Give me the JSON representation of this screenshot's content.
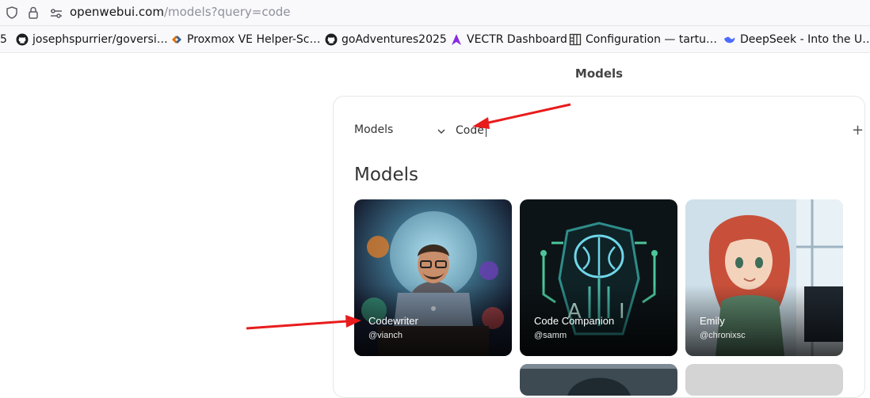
{
  "browser": {
    "url_host": "openwebui.com",
    "url_rest": "/models?query=code",
    "bookmarks": [
      {
        "label": "5",
        "icon": "overflow-icon"
      },
      {
        "label": "josephspurrier/goversi…",
        "icon": "github-icon"
      },
      {
        "label": "Proxmox VE Helper-Sc…",
        "icon": "proxmox-icon"
      },
      {
        "label": "goAdventures2025",
        "icon": "github-icon"
      },
      {
        "label": "VECTR Dashboard",
        "icon": "vectr-icon"
      },
      {
        "label": "Configuration — tartu…",
        "icon": "config-icon"
      },
      {
        "label": "DeepSeek - Into the U…",
        "icon": "deepseek-icon"
      }
    ]
  },
  "page": {
    "title": "Models",
    "filter_label": "Models",
    "search_value": "Code",
    "section_title": "Models",
    "models": [
      {
        "name": "Codewriter",
        "user": "@vianch"
      },
      {
        "name": "Code Companion",
        "user": "@samm"
      },
      {
        "name": "Emily",
        "user": "@chronixsc"
      }
    ]
  },
  "colors": {
    "annotation_arrow": "#e81c1c",
    "accent_text": "#333333"
  }
}
